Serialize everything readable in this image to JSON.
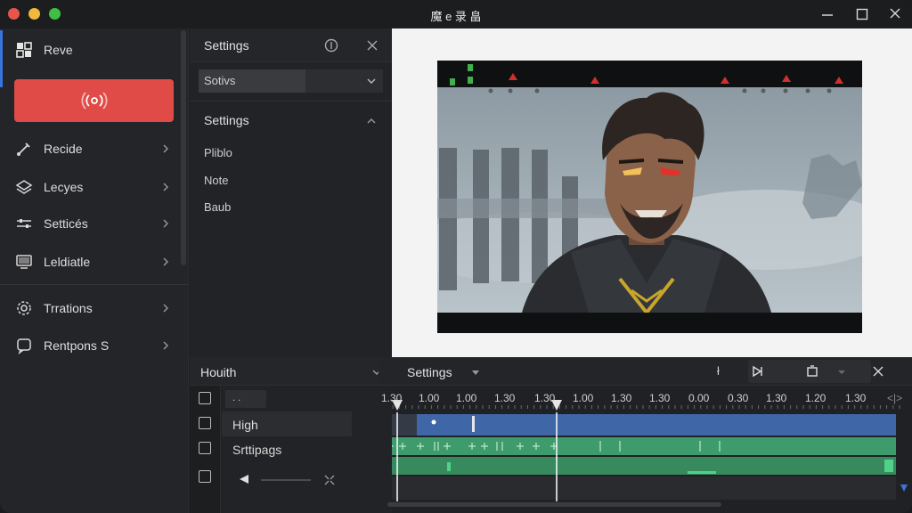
{
  "window": {
    "title": "魔 e 录 畠"
  },
  "sidebar": {
    "items": [
      {
        "label": "Reve",
        "icon": "grid-icon"
      },
      {
        "label": "Recide",
        "icon": "brush-icon"
      },
      {
        "label": "Lecyes",
        "icon": "layers-icon"
      },
      {
        "label": "Setticés",
        "icon": "sliders-icon"
      },
      {
        "label": "Leldiatle",
        "icon": "monitor-icon"
      },
      {
        "label": "Trrations",
        "icon": "gear-icon"
      },
      {
        "label": "Rentpons S",
        "icon": "chat-icon"
      }
    ],
    "primary_button_icon": "broadcast-icon",
    "accent_color": "#3a73e0",
    "button_color": "#e04b48"
  },
  "settings_panel": {
    "title": "Settings",
    "select_value": "Sotivs",
    "section_title": "Settings",
    "options": [
      "Pliblo",
      "Note",
      "Baub"
    ]
  },
  "bottom_left": {
    "title": "Houith",
    "input_value": ". .",
    "rows": [
      "High",
      "Srttipags"
    ]
  },
  "timeline": {
    "title": "Settings",
    "cursor_glyph": "ł",
    "ticks": [
      "1.30",
      "1.00",
      "1.00",
      "1.30",
      "1.30",
      "1.00",
      "1.30",
      "1.30",
      "0.00",
      "0.30",
      "1.30",
      "1.20",
      "1.30"
    ],
    "scroll_arrows": "<|>",
    "track_colors": {
      "video": "#3f66a6",
      "audio": "#3d9b6c",
      "audio2": "#378a5e"
    }
  }
}
